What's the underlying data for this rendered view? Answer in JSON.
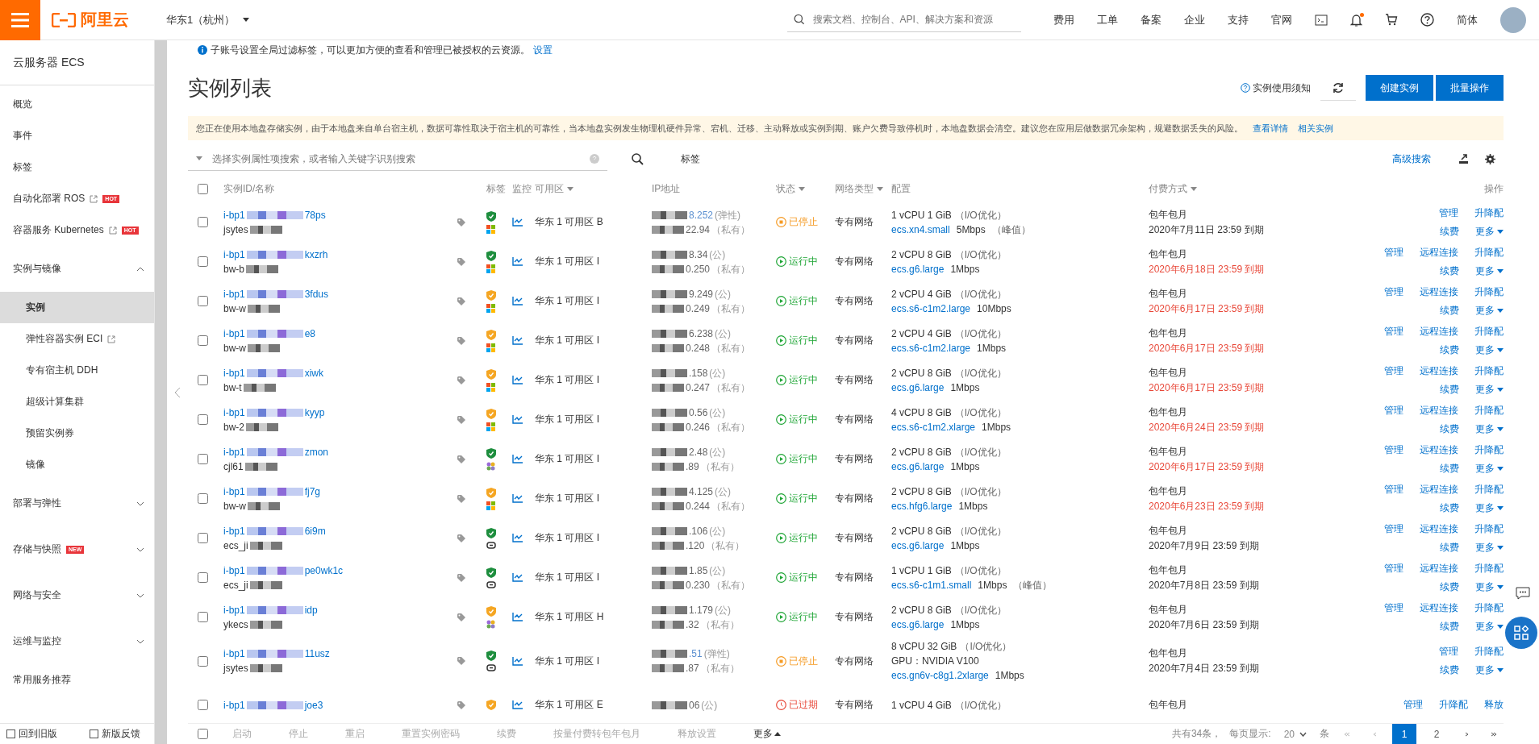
{
  "topbar": {
    "logo": "阿里云",
    "region": "华东1（杭州）",
    "search_placeholder": "搜索文档、控制台、API、解决方案和资源",
    "links": [
      "费用",
      "工单",
      "备案",
      "企业",
      "支持",
      "官网"
    ],
    "language": "简体",
    "notification_dot": true
  },
  "sidebar": {
    "title": "云服务器 ECS",
    "items": [
      {
        "label": "概览",
        "kind": "item",
        "selected": false
      },
      {
        "label": "事件",
        "kind": "item",
        "selected": false
      },
      {
        "label": "标签",
        "kind": "item",
        "selected": false
      },
      {
        "label": "自动化部署 ROS",
        "kind": "item",
        "selected": false,
        "external": true,
        "badge": "HOT"
      },
      {
        "label": "容器服务 Kubernetes",
        "kind": "item",
        "selected": false,
        "external": true,
        "badge": "HOT"
      },
      {
        "label": "实例与镜像",
        "kind": "group",
        "expanded": true,
        "children": [
          {
            "label": "实例",
            "selected": true
          },
          {
            "label": "弹性容器实例 ECI",
            "selected": false,
            "external": true
          },
          {
            "label": "专有宿主机 DDH",
            "selected": false
          },
          {
            "label": "超级计算集群",
            "selected": false
          },
          {
            "label": "预留实例券",
            "selected": false
          },
          {
            "label": "镜像",
            "selected": false
          }
        ]
      },
      {
        "label": "部署与弹性",
        "kind": "group",
        "expanded": false
      },
      {
        "label": "存储与快照",
        "kind": "group",
        "expanded": false,
        "badge": "NEW"
      },
      {
        "label": "网络与安全",
        "kind": "group",
        "expanded": false
      },
      {
        "label": "运维与监控",
        "kind": "group",
        "expanded": false
      },
      {
        "label": "常用服务推荐",
        "kind": "item",
        "selected": false
      }
    ],
    "footer": [
      "回到旧版",
      "新版反馈"
    ]
  },
  "notice": {
    "text": "子账号设置全局过滤标签，可以更加方便的查看和管理已被授权的云资源。",
    "link": "设置"
  },
  "page_title": "实例列表",
  "header_actions": {
    "help": "实例使用须知",
    "primary": "创建实例",
    "secondary": "批量操作"
  },
  "warning": {
    "text": "您正在使用本地盘存储实例，由于本地盘来自单台宿主机，数据可靠性取决于宿主机的可靠性，当本地盘实例发生物理机硬件异常、宕机、迁移、主动释放或实例到期、账户欠费导致停机时，本地盘数据会清空。建议您在应用层做数据冗余架构，规避数据丢失的风险。",
    "links": [
      "查看详情",
      "相关实例"
    ]
  },
  "filter": {
    "placeholder": "选择实例属性项搜索，或者输入关键字识别搜索",
    "tag_label": "标签",
    "advanced": "高级搜索"
  },
  "table": {
    "all_checked": false,
    "columns": [
      "实例ID/名称",
      "标签",
      "监控",
      "可用区",
      "IP地址",
      "状态",
      "网络类型",
      "配置",
      "付费方式",
      "操作"
    ],
    "rows": [
      {
        "id_prefix": "i-bp1",
        "id_suffix": "78ps",
        "name": "jsytes",
        "security": {
          "color": "#1e8e3e"
        },
        "checked": false,
        "os": {
          "kind": "windows"
        },
        "zone": "华东 1 可用区 B",
        "public_ip": "8.252",
        "public_ip_type": "(弹性)",
        "elastic": true,
        "private_ip": "22.94",
        "private_ip_type": "（私有）",
        "status": {
          "kind": "stopped",
          "label": "已停止"
        },
        "network": "专有网络",
        "spec": "1 vCPU 1 GiB",
        "io": "（I/O优化）",
        "instance_type": "ecs.xn4.small",
        "bandwidth": "5Mbps",
        "peak": "（峰值）",
        "billing": "包年包月",
        "expiry": "2020年7月11日 23:59 到期",
        "expiring": false,
        "actions_top": [
          "管理",
          "升降配"
        ],
        "actions_bottom": [
          "续费",
          "更多"
        ]
      },
      {
        "id_prefix": "i-bp1",
        "id_suffix": "kxzrh",
        "name": "bw-b",
        "security": {
          "color": "#1e8e3e"
        },
        "checked": false,
        "os": {
          "kind": "windows"
        },
        "zone": "华东 1 可用区 I",
        "public_ip": "8.34",
        "public_ip_type": "(公)",
        "elastic": false,
        "private_ip": "0.250",
        "private_ip_type": "（私有）",
        "status": {
          "kind": "running",
          "label": "运行中"
        },
        "network": "专有网络",
        "spec": "2 vCPU 8 GiB",
        "io": "（I/O优化）",
        "instance_type": "ecs.g6.large",
        "bandwidth": "1Mbps",
        "billing": "包年包月",
        "expiry": "2020年6月18日 23:59 到期",
        "expiring": true,
        "actions_top": [
          "管理",
          "远程连接",
          "升降配"
        ],
        "actions_bottom": [
          "续费",
          "更多"
        ]
      },
      {
        "id_prefix": "i-bp1",
        "id_suffix": "3fdus",
        "name": "bw-w",
        "security": {
          "color": "#f5a623"
        },
        "checked": false,
        "os": {
          "kind": "windows"
        },
        "zone": "华东 1 可用区 I",
        "public_ip": "9.249",
        "public_ip_type": "(公)",
        "elastic": false,
        "private_ip": "0.249",
        "private_ip_type": "（私有）",
        "status": {
          "kind": "running",
          "label": "运行中"
        },
        "network": "专有网络",
        "spec": "2 vCPU 4 GiB",
        "io": "（I/O优化）",
        "instance_type": "ecs.s6-c1m2.large",
        "bandwidth": "10Mbps",
        "billing": "包年包月",
        "expiry": "2020年6月17日 23:59 到期",
        "expiring": true,
        "actions_top": [
          "管理",
          "远程连接",
          "升降配"
        ],
        "actions_bottom": [
          "续费",
          "更多"
        ]
      },
      {
        "id_prefix": "i-bp1",
        "id_suffix": "e8",
        "name": "bw-w",
        "security": {
          "color": "#f5a623"
        },
        "checked": false,
        "os": {
          "kind": "windows"
        },
        "zone": "华东 1 可用区 I",
        "public_ip": "6.238",
        "public_ip_type": "(公)",
        "elastic": false,
        "private_ip": "0.248",
        "private_ip_type": "（私有）",
        "status": {
          "kind": "running",
          "label": "运行中"
        },
        "network": "专有网络",
        "spec": "2 vCPU 4 GiB",
        "io": "（I/O优化）",
        "instance_type": "ecs.s6-c1m2.large",
        "bandwidth": "1Mbps",
        "billing": "包年包月",
        "expiry": "2020年6月17日 23:59 到期",
        "expiring": true,
        "actions_top": [
          "管理",
          "远程连接",
          "升降配"
        ],
        "actions_bottom": [
          "续费",
          "更多"
        ]
      },
      {
        "id_prefix": "i-bp1",
        "id_suffix": "xiwk",
        "name": "bw-t",
        "security": {
          "color": "#f5a623"
        },
        "checked": false,
        "os": {
          "kind": "windows"
        },
        "zone": "华东 1 可用区 I",
        "public_ip": ".158",
        "public_ip_type": "(公)",
        "elastic": false,
        "private_ip": "0.247",
        "private_ip_type": "（私有）",
        "status": {
          "kind": "running",
          "label": "运行中"
        },
        "network": "专有网络",
        "spec": "2 vCPU 8 GiB",
        "io": "（I/O优化）",
        "instance_type": "ecs.g6.large",
        "bandwidth": "1Mbps",
        "billing": "包年包月",
        "expiry": "2020年6月17日 23:59 到期",
        "expiring": true,
        "actions_top": [
          "管理",
          "远程连接",
          "升降配"
        ],
        "actions_bottom": [
          "续费",
          "更多"
        ]
      },
      {
        "id_prefix": "i-bp1",
        "id_suffix": "kyyp",
        "name": "bw-2",
        "security": {
          "color": "#f5a623"
        },
        "checked": false,
        "os": {
          "kind": "windows"
        },
        "zone": "华东 1 可用区 I",
        "public_ip": "0.56",
        "public_ip_type": "(公)",
        "elastic": false,
        "private_ip": "0.246",
        "private_ip_type": "（私有）",
        "status": {
          "kind": "running",
          "label": "运行中"
        },
        "network": "专有网络",
        "spec": "4 vCPU 8 GiB",
        "io": "（I/O优化）",
        "instance_type": "ecs.s6-c1m2.xlarge",
        "bandwidth": "1Mbps",
        "billing": "包年包月",
        "expiry": "2020年6月24日 23:59 到期",
        "expiring": true,
        "actions_top": [
          "管理",
          "远程连接",
          "升降配"
        ],
        "actions_bottom": [
          "续费",
          "更多"
        ]
      },
      {
        "id_prefix": "i-bp1",
        "id_suffix": "zmon",
        "name": "cjl61",
        "security": {
          "color": "#1e8e3e"
        },
        "checked": false,
        "os": {
          "kind": "other"
        },
        "zone": "华东 1 可用区 I",
        "public_ip": "2.48",
        "public_ip_type": "(公)",
        "elastic": false,
        "private_ip": ".89",
        "private_ip_type": "（私有）",
        "status": {
          "kind": "running",
          "label": "运行中"
        },
        "network": "专有网络",
        "spec": "2 vCPU 8 GiB",
        "io": "（I/O优化）",
        "instance_type": "ecs.g6.large",
        "bandwidth": "1Mbps",
        "billing": "包年包月",
        "expiry": "2020年6月17日 23:59 到期",
        "expiring": true,
        "actions_top": [
          "管理",
          "远程连接",
          "升降配"
        ],
        "actions_bottom": [
          "续费",
          "更多"
        ]
      },
      {
        "id_prefix": "i-bp1",
        "id_suffix": "fj7g",
        "name": "bw-w",
        "security": {
          "color": "#f5a623"
        },
        "checked": false,
        "os": {
          "kind": "windows"
        },
        "zone": "华东 1 可用区 I",
        "public_ip": "4.125",
        "public_ip_type": "(公)",
        "elastic": false,
        "private_ip": "0.244",
        "private_ip_type": "（私有）",
        "status": {
          "kind": "running",
          "label": "运行中"
        },
        "network": "专有网络",
        "spec": "2 vCPU 8 GiB",
        "io": "（I/O优化）",
        "instance_type": "ecs.hfg6.large",
        "bandwidth": "1Mbps",
        "billing": "包年包月",
        "expiry": "2020年6月23日 23:59 到期",
        "expiring": true,
        "actions_top": [
          "管理",
          "远程连接",
          "升降配"
        ],
        "actions_bottom": [
          "续费",
          "更多"
        ]
      },
      {
        "id_prefix": "i-bp1",
        "id_suffix": "6i9m",
        "name": "ecs_ji",
        "security": {
          "color": "#1e8e3e"
        },
        "checked": false,
        "os": {
          "kind": "linux"
        },
        "zone": "华东 1 可用区 I",
        "public_ip": ".106",
        "public_ip_type": "(公)",
        "elastic": false,
        "private_ip": ".120",
        "private_ip_type": "（私有）",
        "status": {
          "kind": "running",
          "label": "运行中"
        },
        "network": "专有网络",
        "spec": "2 vCPU 8 GiB",
        "io": "（I/O优化）",
        "instance_type": "ecs.g6.large",
        "bandwidth": "1Mbps",
        "billing": "包年包月",
        "expiry": "2020年7月9日 23:59 到期",
        "expiring": false,
        "actions_top": [
          "管理",
          "远程连接",
          "升降配"
        ],
        "actions_bottom": [
          "续费",
          "更多"
        ]
      },
      {
        "id_prefix": "i-bp1",
        "id_suffix": "pe0wk1c",
        "name": "ecs_ji",
        "security": {
          "color": "#1e8e3e"
        },
        "checked": false,
        "os": {
          "kind": "linux"
        },
        "zone": "华东 1 可用区 I",
        "public_ip": "1.85",
        "public_ip_type": "(公)",
        "elastic": false,
        "private_ip": "0.230",
        "private_ip_type": "（私有）",
        "status": {
          "kind": "running",
          "label": "运行中"
        },
        "network": "专有网络",
        "spec": "1 vCPU 1 GiB",
        "io": "（I/O优化）",
        "instance_type": "ecs.s6-c1m1.small",
        "bandwidth": "1Mbps",
        "peak": "（峰值）",
        "billing": "包年包月",
        "expiry": "2020年7月8日 23:59 到期",
        "expiring": false,
        "actions_top": [
          "管理",
          "远程连接",
          "升降配"
        ],
        "actions_bottom": [
          "续费",
          "更多"
        ]
      },
      {
        "id_prefix": "i-bp1",
        "id_suffix": "idp",
        "name": "ykecs",
        "security": {
          "color": "#f5a623"
        },
        "checked": false,
        "os": {
          "kind": "other"
        },
        "zone": "华东 1 可用区 H",
        "public_ip": "1.179",
        "public_ip_type": "(公)",
        "elastic": false,
        "private_ip": ".32",
        "private_ip_type": "（私有）",
        "status": {
          "kind": "running",
          "label": "运行中"
        },
        "network": "专有网络",
        "spec": "2 vCPU 8 GiB",
        "io": "（I/O优化）",
        "instance_type": "ecs.g6.large",
        "bandwidth": "1Mbps",
        "billing": "包年包月",
        "expiry": "2020年7月6日 23:59 到期",
        "expiring": false,
        "actions_top": [
          "管理",
          "远程连接",
          "升降配"
        ],
        "actions_bottom": [
          "续费",
          "更多"
        ]
      },
      {
        "id_prefix": "i-bp1",
        "id_suffix": "11usz",
        "name": "jsytes",
        "security": {
          "color": "#1e8e3e"
        },
        "checked": false,
        "os": {
          "kind": "linux"
        },
        "zone": "华东 1 可用区 I",
        "public_ip": ".51",
        "public_ip_type": "(弹性)",
        "elastic": true,
        "private_ip": ".87",
        "private_ip_type": "（私有）",
        "status": {
          "kind": "stopped",
          "label": "已停止"
        },
        "network": "专有网络",
        "spec": "8 vCPU 32 GiB",
        "io": "（I/O优化）",
        "gpu": "GPU：NVIDIA V100",
        "instance_type": "ecs.gn6v-c8g1.2xlarge",
        "bandwidth": "1Mbps",
        "billing": "包年包月",
        "expiry": "2020年7月4日 23:59 到期",
        "expiring": false,
        "actions_top": [
          "管理",
          "升降配"
        ],
        "actions_bottom": [
          "续费",
          "更多"
        ]
      },
      {
        "id_prefix": "i-bp1",
        "id_suffix": "joe3",
        "security": {
          "color": "#f5a623"
        },
        "checked": false,
        "zone": "华东 1 可用区 E",
        "public_ip": "06",
        "public_ip_type": "(公)",
        "elastic": false,
        "status": {
          "kind": "expired",
          "label": "已过期"
        },
        "network": "专有网络",
        "spec": "1 vCPU 4 GiB",
        "io": "（I/O优化）",
        "billing": "包年包月",
        "actions_top": [
          "管理",
          "升降配",
          "释放"
        ]
      }
    ]
  },
  "batch_checked": false,
  "batch_actions": [
    "启动",
    "停止",
    "重启",
    "重置实例密码",
    "续费",
    "按量付费转包年包月",
    "释放设置"
  ],
  "batch_more": "更多",
  "pagination": {
    "total": "共有34条，",
    "page_size_label": "每页显示:",
    "page_size": "20",
    "unit": "条",
    "pages": [
      {
        "label": "1",
        "selected": true
      },
      {
        "label": "2",
        "selected": false
      }
    ]
  }
}
